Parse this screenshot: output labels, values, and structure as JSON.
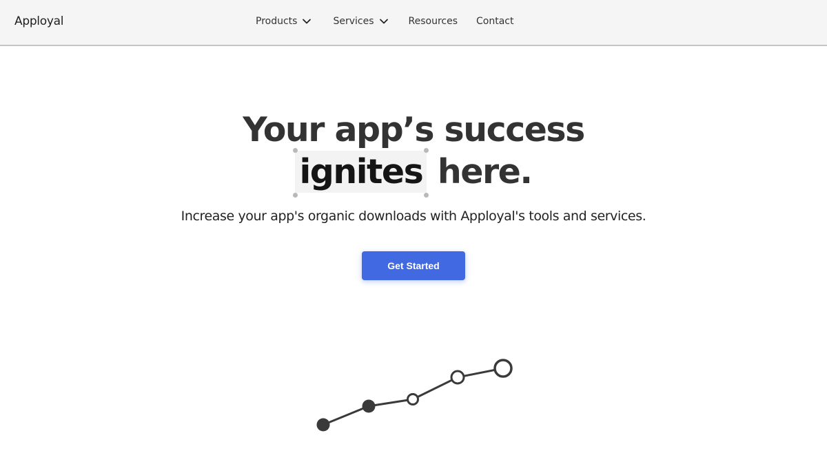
{
  "header": {
    "logo": "Apployal",
    "nav": [
      {
        "label": "Products",
        "has_dropdown": true,
        "icon": "chevron-down-icon"
      },
      {
        "label": "Services",
        "has_dropdown": true,
        "icon": "chevron-down-icon"
      },
      {
        "label": "Resources",
        "has_dropdown": false
      },
      {
        "label": "Contact",
        "has_dropdown": false
      }
    ]
  },
  "hero": {
    "title_line1": "Your app’s success",
    "title_highlight": "ignites",
    "title_line2_rest": "here.",
    "subtitle": "Increase your app's organic downloads with Apployal's tools and services.",
    "cta_label": "Get Started"
  },
  "colors": {
    "primary": "#4169e1",
    "text": "#333333",
    "navbar_bg": "#f5f5f5",
    "highlight_bg": "#f3f3f3"
  },
  "illustration": {
    "name": "growth-line-icon",
    "points": [
      {
        "step": 1,
        "style": "filled"
      },
      {
        "step": 2,
        "style": "filled"
      },
      {
        "step": 3,
        "style": "hollow"
      },
      {
        "step": 4,
        "style": "hollow"
      },
      {
        "step": 5,
        "style": "hollow"
      }
    ]
  }
}
